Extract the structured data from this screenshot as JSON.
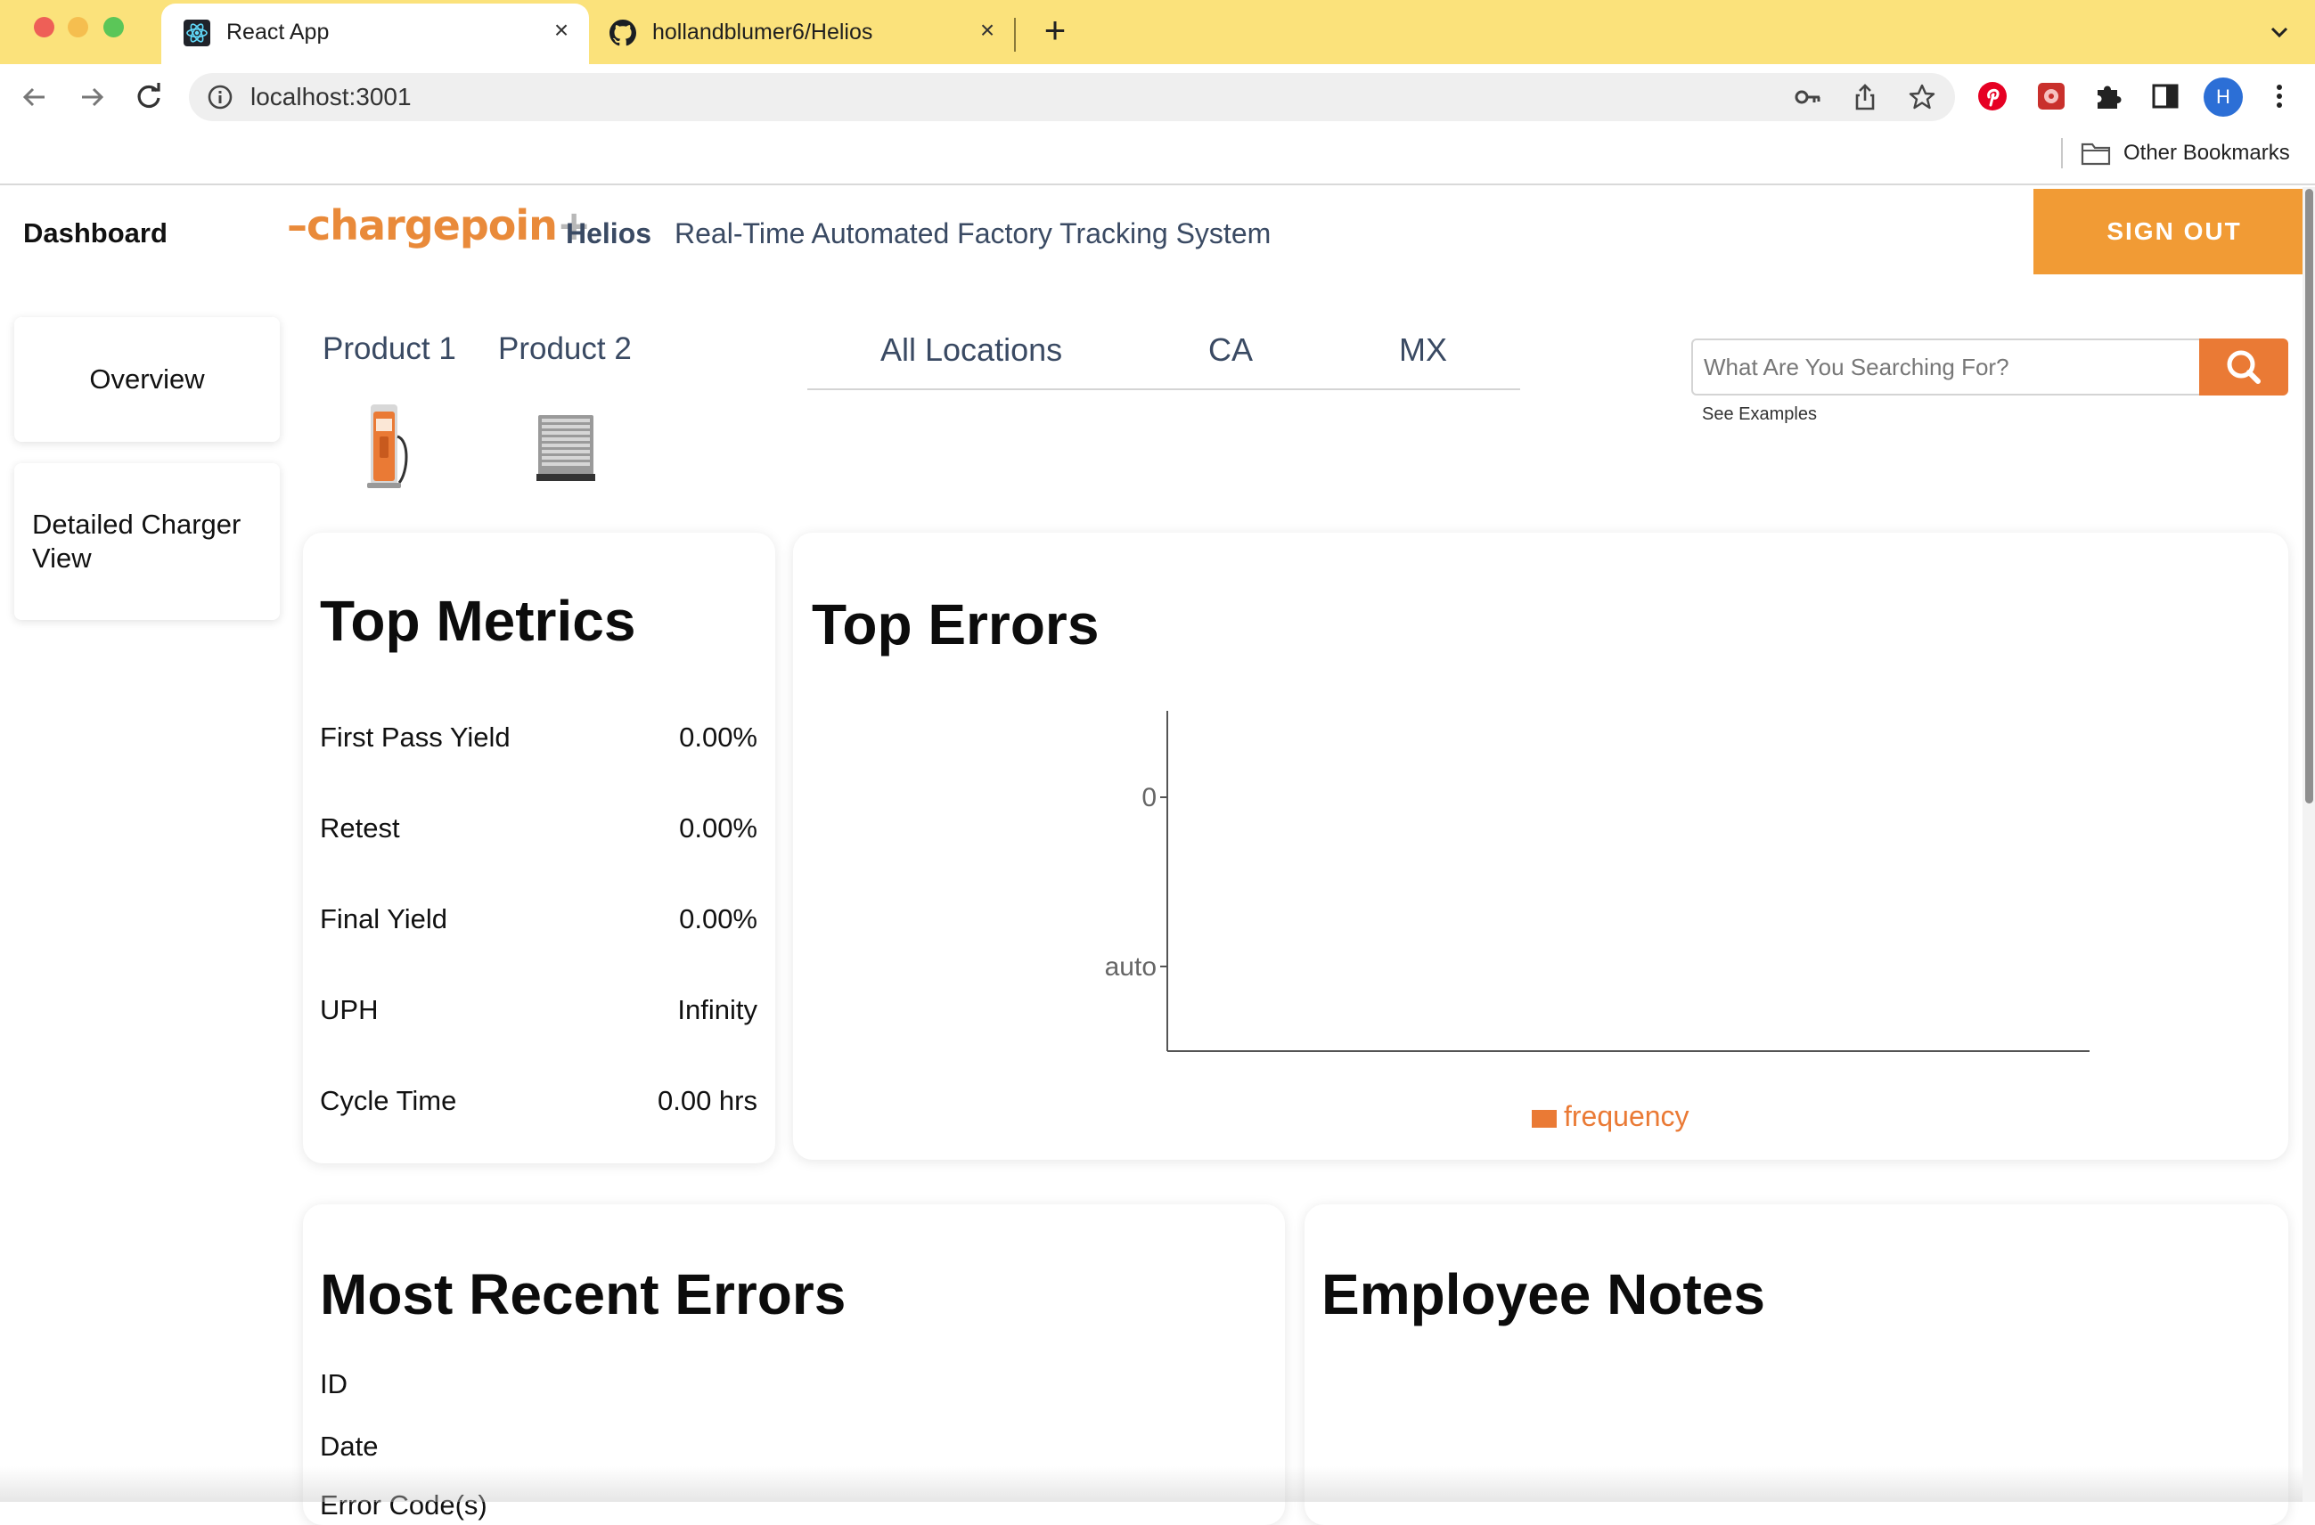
{
  "browser": {
    "tabs": [
      {
        "title": "React App",
        "active": true,
        "icon": "react-icon"
      },
      {
        "title": "hollandblumer6/Helios",
        "active": false,
        "icon": "github-icon"
      }
    ],
    "url": "localhost:3001",
    "bookmarks": {
      "other": "Other Bookmarks"
    },
    "profile_initial": "H",
    "titlebar_color": "#fbe27b"
  },
  "header": {
    "dashboard_label": "Dashboard",
    "logo": {
      "dash": "–",
      "text": "chargepoin",
      "tail": "+"
    },
    "app_name": "Helios",
    "subtitle": "Real-Time Automated Factory Tracking System",
    "sign_out": "SIGN OUT",
    "accent_color": "#f19b35"
  },
  "sidebar": {
    "items": [
      {
        "label": "Overview"
      },
      {
        "label": "Detailed Charger View"
      }
    ]
  },
  "products": [
    {
      "label": "Product 1"
    },
    {
      "label": "Product 2"
    }
  ],
  "locations": [
    {
      "label": "All Locations"
    },
    {
      "label": "CA"
    },
    {
      "label": "MX"
    }
  ],
  "search": {
    "placeholder": "What Are You Searching For?",
    "value": "",
    "examples_link": "See Examples"
  },
  "top_metrics": {
    "title": "Top Metrics",
    "rows": [
      {
        "label": "First Pass Yield",
        "value": "0.00%"
      },
      {
        "label": "Retest",
        "value": "0.00%"
      },
      {
        "label": "Final Yield",
        "value": "0.00%"
      },
      {
        "label": "UPH",
        "value": "Infinity"
      },
      {
        "label": "Cycle Time",
        "value": "0.00 hrs"
      }
    ]
  },
  "top_errors": {
    "title": "Top Errors"
  },
  "chart_data": {
    "type": "bar",
    "title": "",
    "categories": [],
    "series": [
      {
        "name": "frequency",
        "values": [],
        "color": "#ea7a35"
      }
    ],
    "yticks": [
      "0",
      "auto"
    ],
    "xlabel": "",
    "ylabel": "",
    "legend": "bottom-center"
  },
  "recent_errors": {
    "title": "Most Recent Errors",
    "fields": [
      "ID",
      "Date",
      "Error Code(s)"
    ]
  },
  "employee_notes": {
    "title": "Employee Notes"
  }
}
